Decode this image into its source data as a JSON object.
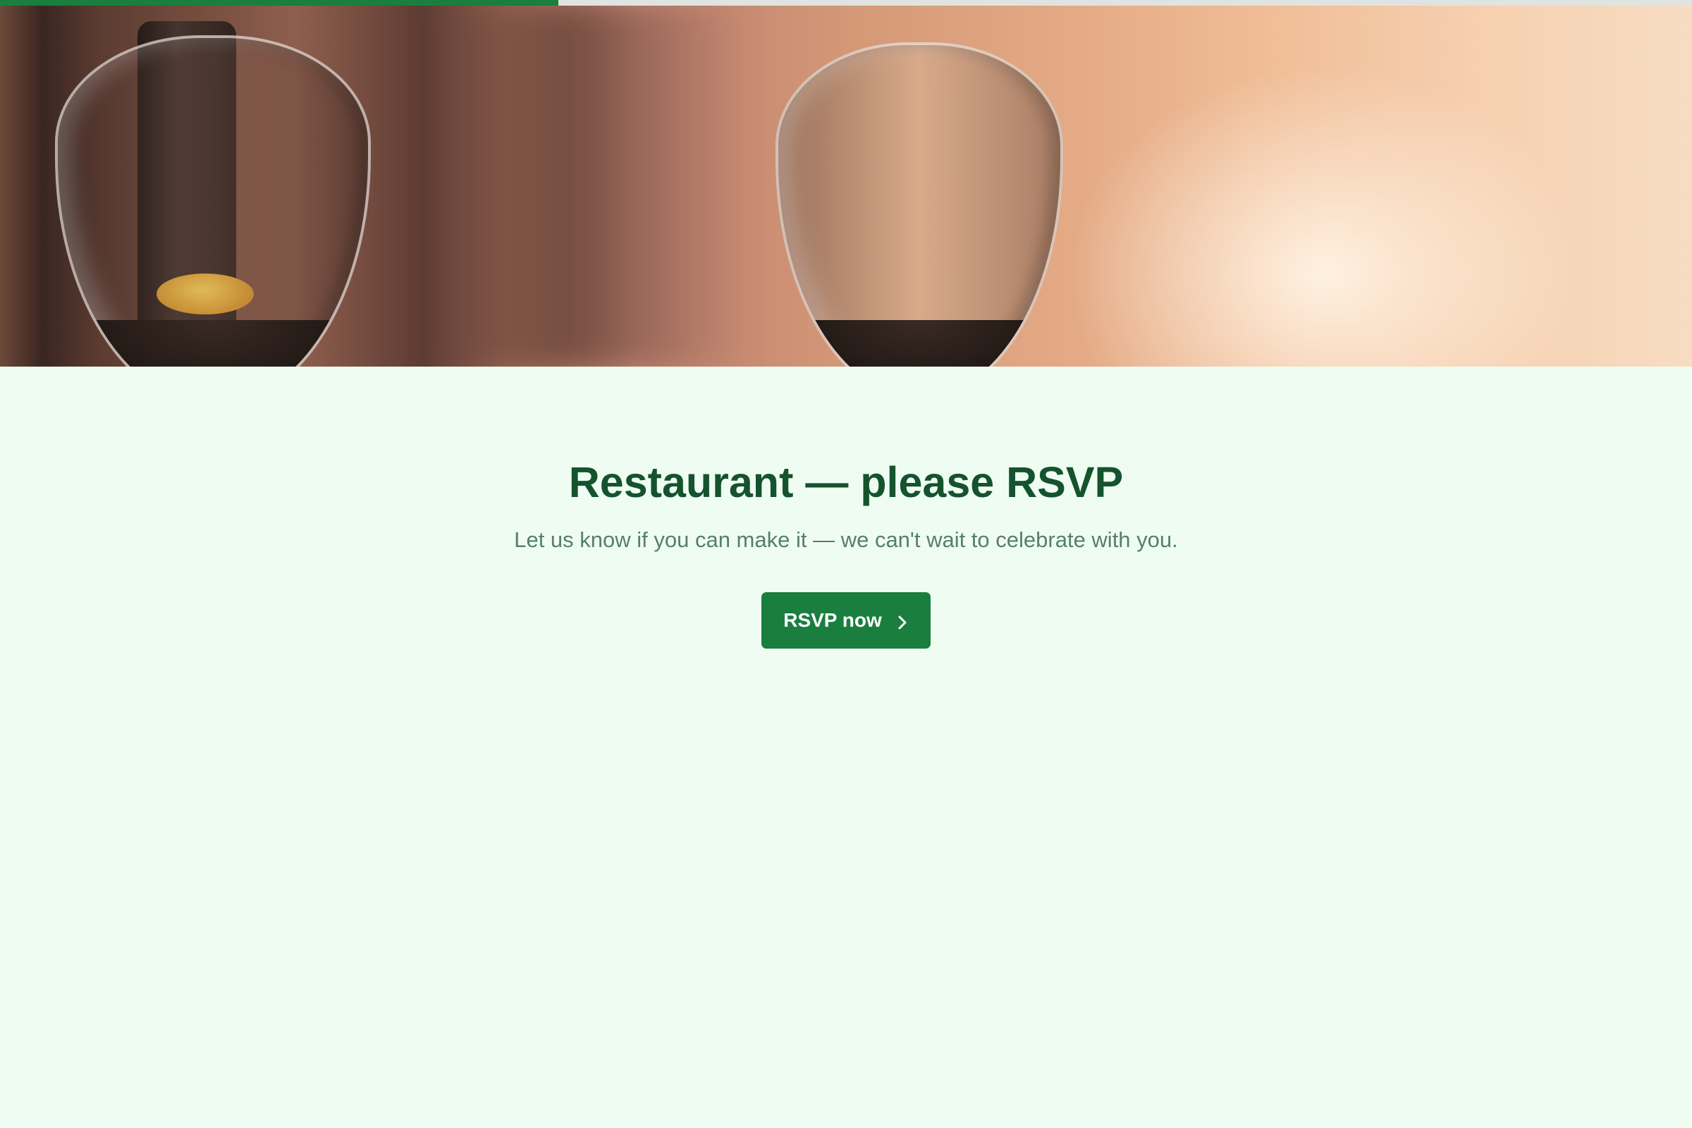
{
  "progress": {
    "value_fraction": 0.33,
    "fill_color": "#1a7e3f",
    "track_color": "#dfe4e1"
  },
  "hero": {
    "image": "wine-glasses-photo"
  },
  "main": {
    "title": "Restaurant — please RSVP",
    "subtitle": "Let us know if you can make it — we can't wait to celebrate with you.",
    "rsvp_button_label": "RSVP now",
    "rsvp_button_icon": "chevron-right-icon"
  },
  "colors": {
    "page_background": "#effcf2",
    "title": "#14532d",
    "subtitle": "#55806a",
    "button": "#1a7e3f"
  }
}
